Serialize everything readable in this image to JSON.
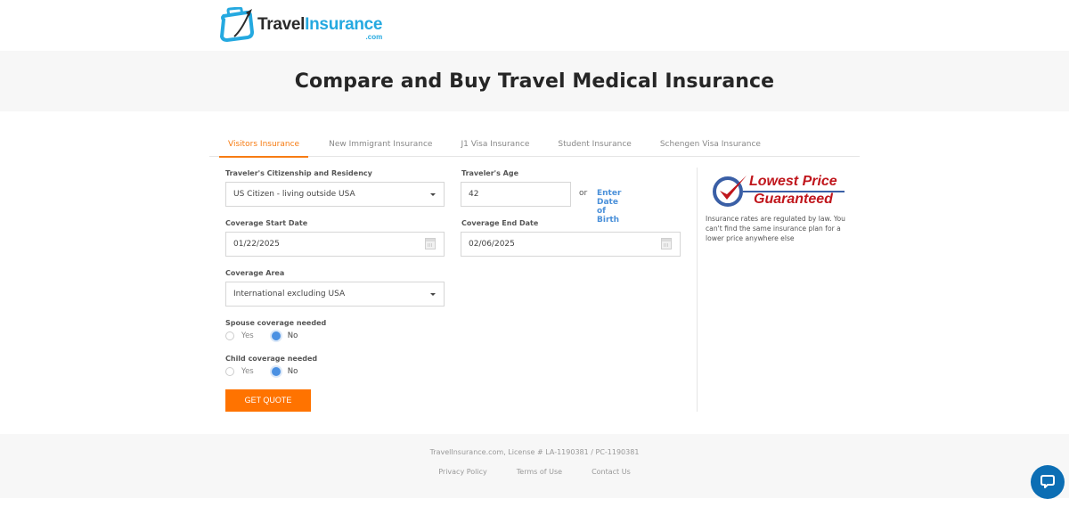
{
  "header": {
    "logo": {
      "travel": "Travel",
      "insurance": "Insurance",
      "com": ".com"
    }
  },
  "hero": {
    "title": "Compare and Buy Travel Medical Insurance"
  },
  "tabs": [
    {
      "label": "Visitors Insurance",
      "active": true
    },
    {
      "label": "New Immigrant Insurance",
      "active": false
    },
    {
      "label": "J1 Visa Insurance",
      "active": false
    },
    {
      "label": "Student Insurance",
      "active": false
    },
    {
      "label": "Schengen Visa Insurance",
      "active": false
    }
  ],
  "form": {
    "citizenship": {
      "label": "Traveler's Citizenship and Residency",
      "value": "US Citizen - living outside USA"
    },
    "age": {
      "label": "Traveler's Age",
      "value": "42",
      "or": "or",
      "dob_link": "Enter Date of Birth"
    },
    "start_date": {
      "label": "Coverage Start Date",
      "value": "01/22/2025"
    },
    "end_date": {
      "label": "Coverage End Date",
      "value": "02/06/2025"
    },
    "area": {
      "label": "Coverage Area",
      "value": "International excluding USA"
    },
    "spouse": {
      "label": "Spouse coverage needed",
      "yes": "Yes",
      "no": "No",
      "selected": "No"
    },
    "child": {
      "label": "Child coverage needed",
      "yes": "Yes",
      "no": "No",
      "selected": "No"
    },
    "submit": "GET QUOTE"
  },
  "badge": {
    "line1": "Lowest Price",
    "line2": "Guaranteed",
    "description": "Insurance rates are regulated by law. You can't find the same insurance plan for a lower price anywhere else"
  },
  "footer": {
    "license": "TravelInsurance.com, License # LA-1190381 / PC-1190381",
    "links": [
      "Privacy Policy",
      "Terms of Use",
      "Contact Us"
    ]
  },
  "colors": {
    "accent": "#ff7300",
    "link": "#4a90d9",
    "chat": "#0c6eb4",
    "badge_red": "#c0161c",
    "badge_blue": "#3a5fa6"
  }
}
